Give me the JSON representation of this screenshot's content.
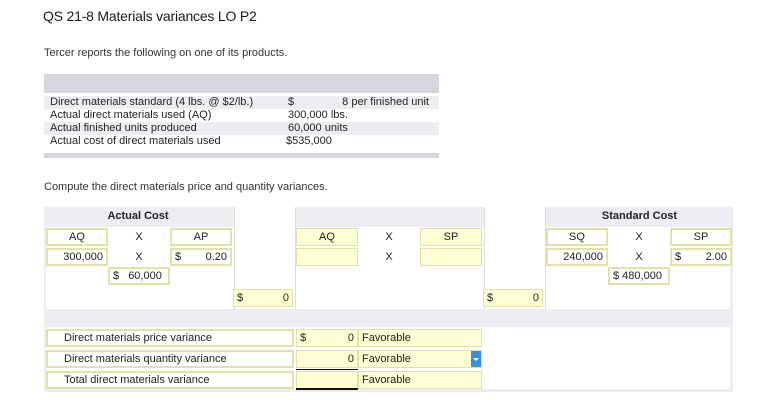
{
  "title": "QS 21-8 Materials variances LO P2",
  "intro": "Tercer reports the following on one of its products.",
  "info": {
    "rows": [
      {
        "label": "Direct materials standard (4 lbs. @ $2/lb.)",
        "value": "$",
        "unit": "8 per finished unit"
      },
      {
        "label": "Actual direct materials used (AQ)",
        "value": "300,000 lbs.",
        "unit": ""
      },
      {
        "label": "Actual finished units produced",
        "value": "60,000 units",
        "unit": ""
      },
      {
        "label": "Actual cost of direct materials used",
        "value": "$535,000",
        "unit": ""
      }
    ]
  },
  "compute_text": "Compute the direct materials price and quantity variances.",
  "worksheet": {
    "actual_cost_header": "Actual Cost",
    "standard_cost_header": "Standard Cost",
    "aq": "AQ",
    "x": "X",
    "ap": "AP",
    "sq": "SQ",
    "sp": "SP",
    "actual_aq_value": "300,000",
    "actual_ap_dollar": "$",
    "actual_ap_value": "0.20",
    "actual_product_dollar": "$",
    "actual_product_value": "60,000",
    "actual_total_dollar": "$",
    "actual_total_value": "0",
    "mid_total_dollar": "$",
    "mid_total_value": "0",
    "std_sq_value": "240,000",
    "std_sp_dollar": "$",
    "std_sp_value": "2.00",
    "std_product_value": "$ 480,000"
  },
  "variances": [
    {
      "label": "Direct materials price variance",
      "dollar": "$",
      "value": "0",
      "type": "Favorable"
    },
    {
      "label": "Direct materials quantity variance",
      "dollar": "",
      "value": "0",
      "type": "Favorable"
    },
    {
      "label": "Total direct materials variance",
      "dollar": "",
      "value": "",
      "type": "Favorable"
    }
  ],
  "colors": {
    "input_fill": "#ffffd5",
    "input_border": "#e2e2a8",
    "dropdown_accent": "#3a8ee0",
    "panel_gray": "#eeeef2"
  }
}
